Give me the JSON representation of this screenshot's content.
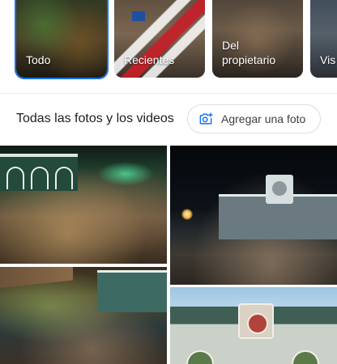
{
  "chips": [
    {
      "label": "Todo",
      "selected": true
    },
    {
      "label": "Recientes",
      "selected": false
    },
    {
      "label": "Del propietario",
      "selected": false
    },
    {
      "label": "Vis",
      "selected": false
    }
  ],
  "section": {
    "title": "Todas las fotos y los videos",
    "add_photo_label": "Agregar una foto",
    "add_photo_icon": "add-photo-camera-icon"
  },
  "colors": {
    "accent": "#1a73e8",
    "divider": "#e8eaed",
    "button_border": "#dadce0"
  }
}
